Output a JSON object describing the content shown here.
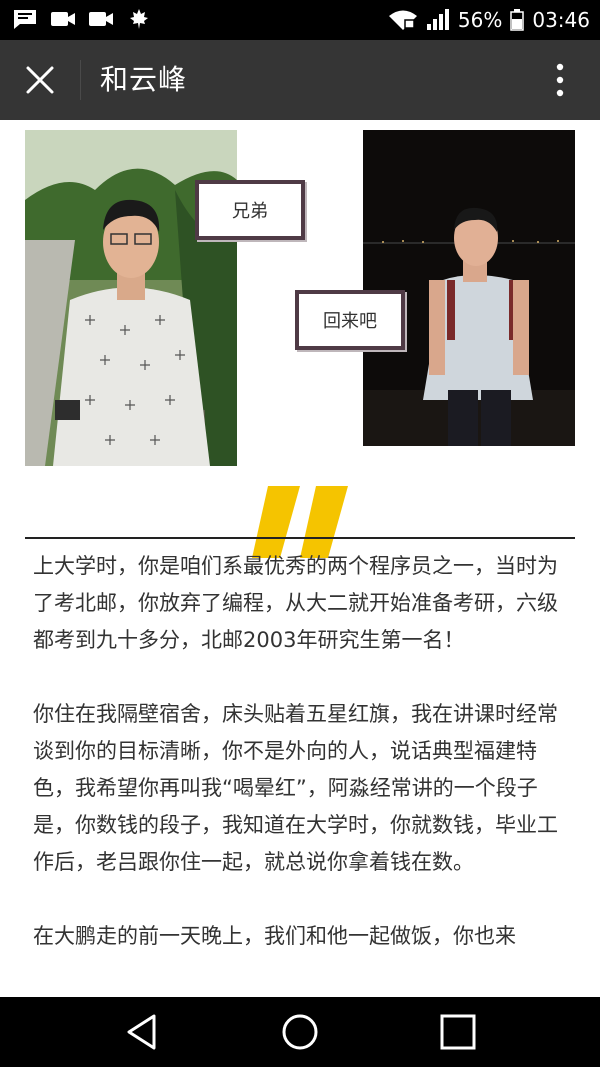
{
  "status_bar": {
    "battery": "56%",
    "time": "03:46",
    "icons": [
      "message-icon",
      "video-icon",
      "video-icon",
      "maple-leaf-icon",
      "wifi-icon",
      "signal-icon",
      "battery-icon"
    ]
  },
  "app_bar": {
    "title": "和云峰",
    "close_icon": "close-icon",
    "more_icon": "more-vert-icon"
  },
  "photos": {
    "caption_1": "兄弟",
    "caption_2": "回来吧"
  },
  "colors": {
    "quote_yellow": "#f5c400",
    "caption_border": "#4f3a45",
    "app_bar_bg": "#353535"
  },
  "article": {
    "paragraphs": [
      "上大学时，你是咱们系最优秀的两个程序员之一，当时为了考北邮，你放弃了编程，从大二就开始准备考研，六级都考到九十多分，北邮2003年研究生第一名！",
      "你住在我隔壁宿舍，床头贴着五星红旗，我在讲课时经常谈到你的目标清晰，你不是外向的人，说话典型福建特色，我希望你再叫我“喝晕红”，阿淼经常讲的一个段子是，你数钱的段子，我知道在大学时，你就数钱，毕业工作后，老吕跟你住一起，就总说你拿着钱在数。",
      "在大鹏走的前一天晚上，我们和他一起做饭，你也来"
    ]
  },
  "nav_bar": {
    "icons": [
      "back-icon",
      "home-icon",
      "recents-icon"
    ]
  }
}
